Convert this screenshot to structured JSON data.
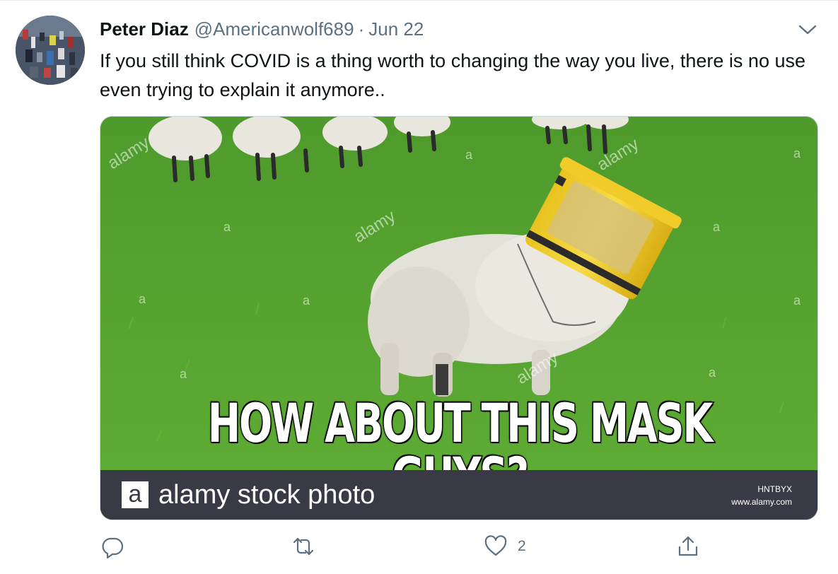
{
  "tweet": {
    "author_name": "Peter Diaz",
    "handle": "@Americanwolf689",
    "separator": "·",
    "date": "Jun 22",
    "text": "If you still think COVID is a thing worth to changing the way you live, there is no use even trying to explain it anymore.."
  },
  "media": {
    "meme_caption": "HOW ABOUT THIS MASK GUYS?",
    "watermark": "alamy",
    "watermark_letter": "a",
    "logo_letter": "a",
    "brand_text": "alamy stock photo",
    "image_code": "HNTBYX",
    "site": "www.alamy.com"
  },
  "actions": {
    "reply_icon": "reply-icon",
    "retweet_icon": "retweet-icon",
    "like_icon": "like-icon",
    "like_count": "2",
    "share_icon": "share-icon"
  },
  "colors": {
    "secondary_text": "#5b7083",
    "grass": "#58a531",
    "bucket": "#f2cf2b",
    "alamy_bar": "#3a3946"
  }
}
